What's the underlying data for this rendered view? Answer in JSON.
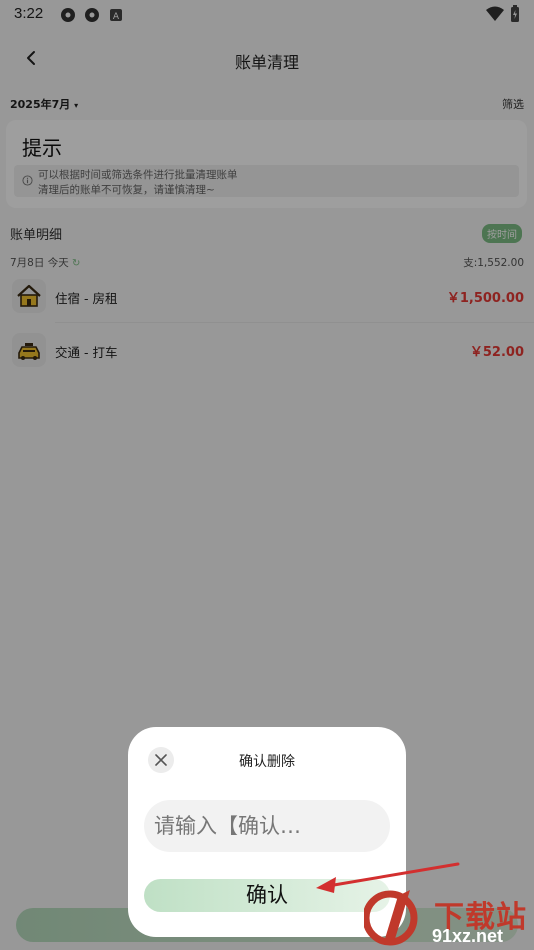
{
  "status_bar": {
    "time": "3:22",
    "left_icons": [
      "aperture-icon",
      "aperture-icon",
      "notification-a-icon"
    ],
    "right_icons": [
      "wifi-icon",
      "battery-charging-icon"
    ]
  },
  "header": {
    "title": "账单清理",
    "back_icon": "chevron-left-icon"
  },
  "filter": {
    "month": "2025年7月",
    "filter_label": "筛选"
  },
  "tip": {
    "title": "提示",
    "line1": "可以根据时间或筛选条件进行批量清理账单",
    "line2": "清理后的账单不可恢复，请谨慎清理~"
  },
  "list": {
    "section_label": "账单明细",
    "sort_badge": "按时间",
    "date": "7月8日 今天",
    "day_total": "支:1,552.00",
    "items": [
      {
        "name": "住宿 - 房租",
        "amount": "￥1,500.00",
        "icon": "house-icon"
      },
      {
        "name": "交通 - 打车",
        "amount": "￥52.00",
        "icon": "taxi-icon"
      }
    ]
  },
  "dialog": {
    "title": "确认删除",
    "input_placeholder": "请输入【确认…",
    "confirm_label": "确认",
    "close_icon": "close-icon"
  },
  "watermark": {
    "text": "下载站",
    "url": "91xz.net"
  },
  "colors": {
    "accent_green": "#7dbd85",
    "amount_red": "#e53935",
    "arrow_red": "#d32f2f"
  }
}
